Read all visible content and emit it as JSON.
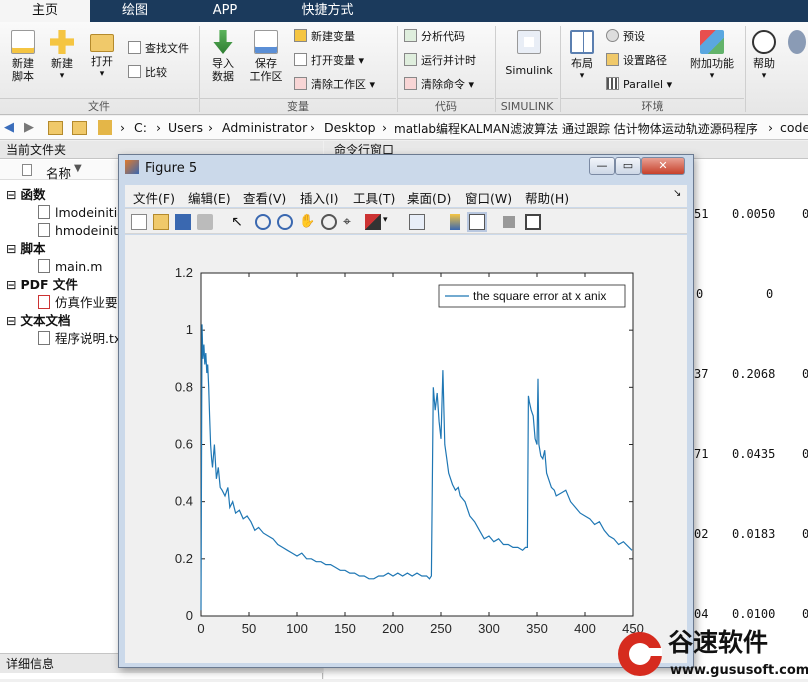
{
  "tabs": [
    {
      "label": "主页",
      "active": true
    },
    {
      "label": "绘图"
    },
    {
      "label": "APP"
    },
    {
      "label": "快捷方式"
    }
  ],
  "ribbon": {
    "new_script": "新建\n脚本",
    "new": "新建",
    "open": "打开",
    "find_files": "查找文件",
    "compare": "比较",
    "import_data": "导入\n数据",
    "save_workspace": "保存\n工作区",
    "new_variable": "新建变量",
    "open_variable": "打开变量",
    "clear_workspace": "清除工作区",
    "analyze_code": "分析代码",
    "run_and_time": "运行并计时",
    "clear_commands": "清除命令",
    "simulink": "Simulink",
    "layout": "布局",
    "preferences": "预设",
    "set_path": "设置路径",
    "parallel": "Parallel",
    "addons": "附加功能",
    "help": "帮助",
    "groups": {
      "file": "文件",
      "variable": "变量",
      "code": "代码",
      "simulink": "SIMULINK",
      "environment": "环境"
    }
  },
  "address": {
    "crumbs": [
      "C:",
      "Users",
      "Administrator",
      "Desktop",
      "matlab编程KALMAN滤波算法 通过跟踪 估计物体运动轨迹源码程序",
      "code"
    ]
  },
  "current_folder": {
    "title": "当前文件夹",
    "col_name": "名称",
    "groups": [
      {
        "label": "函数",
        "files": [
          "lmodeinitia",
          "hmodeiniti"
        ]
      },
      {
        "label": "脚本",
        "files": [
          "main.m"
        ]
      },
      {
        "label": "PDF 文件",
        "files": [
          "仿真作业要"
        ]
      },
      {
        "label": "文本文档",
        "files": [
          "程序说明.tx"
        ]
      }
    ],
    "details": "详细信息"
  },
  "command_window": {
    "title": "命令行窗口",
    "rows": [
      [
        "51",
        "0.0050",
        "0"
      ],
      [
        "0",
        "0",
        ""
      ],
      [
        "37",
        "0.2068",
        "0"
      ],
      [
        "71",
        "0.0435",
        "0"
      ],
      [
        "02",
        "0.0183",
        "0"
      ],
      [
        "04",
        "0.0100",
        "0"
      ]
    ]
  },
  "figure": {
    "title": "Figure 5",
    "menu": [
      "文件(F)",
      "编辑(E)",
      "查看(V)",
      "插入(I)",
      "工具(T)",
      "桌面(D)",
      "窗口(W)",
      "帮助(H)"
    ]
  },
  "chart_data": {
    "type": "line",
    "title": "",
    "xlabel": "",
    "ylabel": "",
    "xlim": [
      0,
      450
    ],
    "ylim": [
      0,
      1.2
    ],
    "xticks": [
      "0",
      "50",
      "100",
      "150",
      "200",
      "250",
      "300",
      "350",
      "400",
      "450"
    ],
    "yticks": [
      "0",
      "0.2",
      "0.4",
      "0.6",
      "0.8",
      "1",
      "1.2"
    ],
    "legend": "top-right",
    "grid": false,
    "series": [
      {
        "name": "the square error at x anix",
        "color": "#1f77b4",
        "x": [
          0,
          1,
          2,
          3,
          4,
          5,
          6,
          7,
          8,
          9,
          10,
          11,
          12,
          14,
          16,
          18,
          20,
          22,
          25,
          28,
          30,
          33,
          36,
          40,
          44,
          48,
          52,
          56,
          60,
          65,
          70,
          75,
          80,
          85,
          90,
          95,
          100,
          105,
          110,
          115,
          120,
          125,
          130,
          135,
          140,
          145,
          150,
          155,
          160,
          165,
          170,
          175,
          180,
          185,
          190,
          195,
          200,
          205,
          210,
          215,
          220,
          225,
          230,
          235,
          238,
          240,
          242,
          244,
          246,
          248,
          250,
          252,
          254,
          256,
          258,
          260,
          262,
          265,
          268,
          270,
          275,
          280,
          285,
          290,
          295,
          300,
          305,
          310,
          315,
          320,
          325,
          330,
          335,
          338,
          340,
          341,
          342,
          344,
          346,
          348,
          350,
          351,
          352,
          354,
          356,
          358,
          360,
          362,
          365,
          368,
          370,
          375,
          380,
          385,
          390,
          395,
          400,
          405,
          410,
          415,
          420,
          425,
          430,
          435,
          440,
          449
        ],
        "y": [
          0.02,
          1.02,
          0.9,
          0.95,
          0.88,
          0.92,
          0.85,
          0.88,
          0.8,
          0.7,
          0.6,
          0.55,
          0.52,
          0.6,
          0.48,
          0.52,
          0.45,
          0.44,
          0.42,
          0.45,
          0.38,
          0.4,
          0.36,
          0.37,
          0.34,
          0.35,
          0.33,
          0.3,
          0.31,
          0.29,
          0.28,
          0.27,
          0.25,
          0.24,
          0.23,
          0.22,
          0.21,
          0.22,
          0.2,
          0.2,
          0.19,
          0.19,
          0.18,
          0.18,
          0.17,
          0.16,
          0.16,
          0.15,
          0.15,
          0.14,
          0.14,
          0.13,
          0.13,
          0.14,
          0.14,
          0.15,
          0.14,
          0.15,
          0.14,
          0.15,
          0.14,
          0.15,
          0.14,
          0.14,
          0.13,
          0.14,
          0.8,
          0.72,
          0.78,
          0.68,
          0.62,
          0.86,
          0.6,
          0.55,
          0.5,
          0.48,
          0.46,
          0.44,
          0.45,
          0.42,
          0.4,
          0.35,
          0.33,
          0.3,
          0.27,
          0.28,
          0.26,
          0.27,
          0.25,
          0.25,
          0.24,
          0.24,
          0.23,
          0.24,
          0.24,
          0.77,
          0.75,
          0.72,
          0.7,
          0.62,
          0.6,
          0.83,
          0.6,
          0.56,
          0.55,
          0.58,
          0.5,
          0.48,
          0.45,
          0.44,
          0.42,
          0.43,
          0.44,
          0.4,
          0.38,
          0.36,
          0.35,
          0.34,
          0.32,
          0.33,
          0.3,
          0.28,
          0.27,
          0.25,
          0.26,
          0.23
        ]
      }
    ]
  }
}
